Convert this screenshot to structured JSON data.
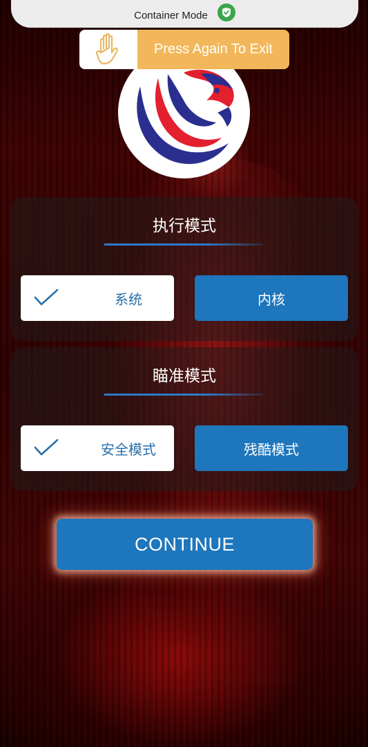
{
  "status_bar": {
    "mode_label": "Container Mode",
    "shield_icon": "shield-check-icon",
    "shield_color": "#3aa54a"
  },
  "toast": {
    "icon": "hand-icon",
    "message": "Press Again To Exit",
    "accent": "#f2b75a"
  },
  "logo": {
    "icon": "eagle-logo-icon",
    "colors": [
      "#e3202e",
      "#2a2f8f",
      "#ffffff"
    ]
  },
  "execution_mode": {
    "title": "执行模式",
    "options": [
      {
        "label": "系统",
        "selected": true
      },
      {
        "label": "内核",
        "selected": false
      }
    ]
  },
  "aim_mode": {
    "title": "瞄准模式",
    "options": [
      {
        "label": "安全模式",
        "selected": true
      },
      {
        "label": "残酷模式",
        "selected": false
      }
    ]
  },
  "continue_button": {
    "label": "CONTINUE",
    "color": "#1e76bc"
  }
}
